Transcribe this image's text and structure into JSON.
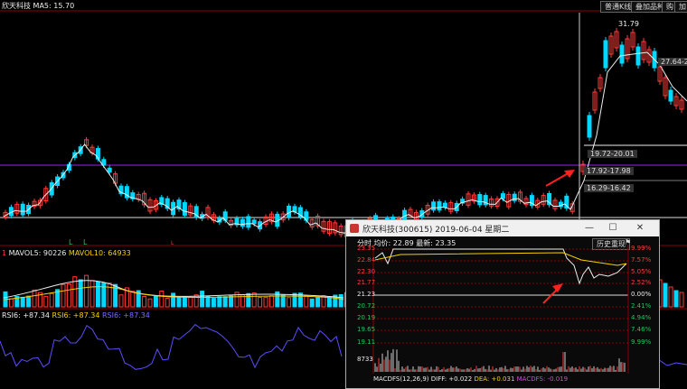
{
  "main": {
    "stock_label": "欣天科技",
    "ma_label": "MA5: 15.70",
    "mode_button": "普通K线",
    "overlay_button": "叠加品种",
    "extra_buttons": [
      "购",
      "加"
    ],
    "high_label": "31.79",
    "price_boxes": [
      "27.64-2",
      "19.72-20.01",
      "17.92-17.98",
      "16.29-16.42"
    ],
    "vol_label_prefix": "1",
    "vol_ma5": "MAVOL5: 90226",
    "vol_ma10": "MAVOL10: 64933",
    "rsi6": "RSI6: +87.34",
    "rsi6b": "RSI6: +87.34",
    "rsi6c": "RSI6: +87.34",
    "markers": [
      "L",
      "L",
      "L"
    ]
  },
  "popup": {
    "title": "欣天科技(300615) 2019-06-04 星期二",
    "info": "分时 均价: 22.89 最新: 23.35",
    "history_button": "历史重现",
    "prices_left": [
      "23.35",
      "22.84",
      "22.30",
      "21.77",
      "21.23",
      "20.72",
      "20.19",
      "19.65",
      "19.11"
    ],
    "pcts_right": [
      "9.99%",
      "7.57%",
      "5.05%",
      "2.52%",
      "0.00%",
      "2.41%",
      "4.94%",
      "7.46%",
      "9.99%"
    ],
    "vol_value": "8733",
    "macd_label": "MACDFS(12,26,9)",
    "diff": "DIFF: +0.022",
    "dea": "DEA: +0.031",
    "macdfs": "MACDFS: -0.019"
  },
  "colors": {
    "up": "#ff3b3b",
    "down": "#00d8ff",
    "grid": "#8b0000",
    "purple": "#a020f0"
  }
}
